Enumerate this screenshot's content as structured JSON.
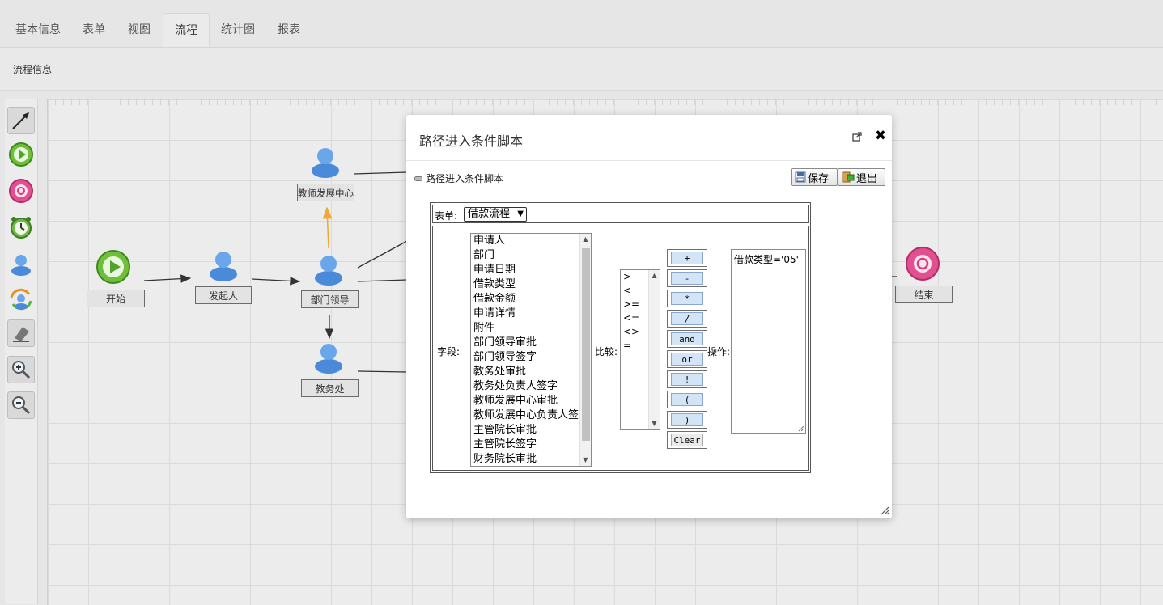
{
  "tabs": [
    {
      "label": "基本信息",
      "active": false
    },
    {
      "label": "表单",
      "active": false
    },
    {
      "label": "视图",
      "active": false
    },
    {
      "label": "流程",
      "active": true
    },
    {
      "label": "统计图",
      "active": false
    },
    {
      "label": "报表",
      "active": false
    }
  ],
  "subheader": {
    "label": "流程信息"
  },
  "toolbar": {
    "tools": [
      "arrow-icon",
      "start-node-icon",
      "end-node-icon",
      "timer-node-icon",
      "user-node-icon",
      "subflow-icon",
      "eraser-icon",
      "zoom-in-icon",
      "zoom-out-icon"
    ]
  },
  "flow": {
    "nodes": {
      "start": "开始",
      "initiator": "发起人",
      "dept_leader": "部门领导",
      "teacher_center": "教师发展中心",
      "academic_office": "教务处",
      "end": "结束"
    },
    "colors": {
      "selected_edge": "#f0a830",
      "edge": "#333333"
    }
  },
  "dialog": {
    "title": "路径进入条件脚本",
    "panel_title": "路径进入条件脚本",
    "save_label": "保存",
    "exit_label": "退出",
    "form_label": "表单:",
    "form_select_value": "借款流程",
    "field_label": "字段:",
    "compare_label": "比较:",
    "operation_label": "操作:",
    "fields": [
      "申请人",
      "部门",
      "申请日期",
      "借款类型",
      "借款金额",
      "申请详情",
      "附件",
      "部门领导审批",
      "部门领导签字",
      "教务处审批",
      "教务处负责人签字",
      "教师发展中心审批",
      "教师发展中心负责人签字",
      "主管院长审批",
      "主管院长签字",
      "财务院长审批"
    ],
    "comparisons": [
      ">",
      "<",
      ">=",
      "<=",
      "<>",
      "="
    ],
    "operators": [
      "+",
      "-",
      "*",
      "/",
      "and",
      "or",
      "!",
      "(",
      ")"
    ],
    "clear_label": "Clear",
    "expression": "借款类型='05'"
  }
}
